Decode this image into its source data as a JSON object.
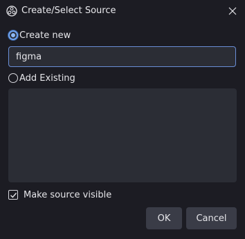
{
  "window": {
    "title": "Create/Select Source",
    "app_icon": "obs-logo-icon",
    "close_icon": "close-icon"
  },
  "options": {
    "create_new_label": "Create new",
    "create_new_checked": true,
    "add_existing_label": "Add Existing",
    "add_existing_checked": false
  },
  "name_input": {
    "value": "figma"
  },
  "existing_sources": [],
  "make_visible": {
    "label": "Make source visible",
    "checked": true
  },
  "buttons": {
    "ok_label": "OK",
    "cancel_label": "Cancel"
  },
  "colors": {
    "background": "#1c1c23",
    "field": "#2b2d35",
    "focus_border": "#6a8fd8",
    "button": "#3a3c47"
  }
}
